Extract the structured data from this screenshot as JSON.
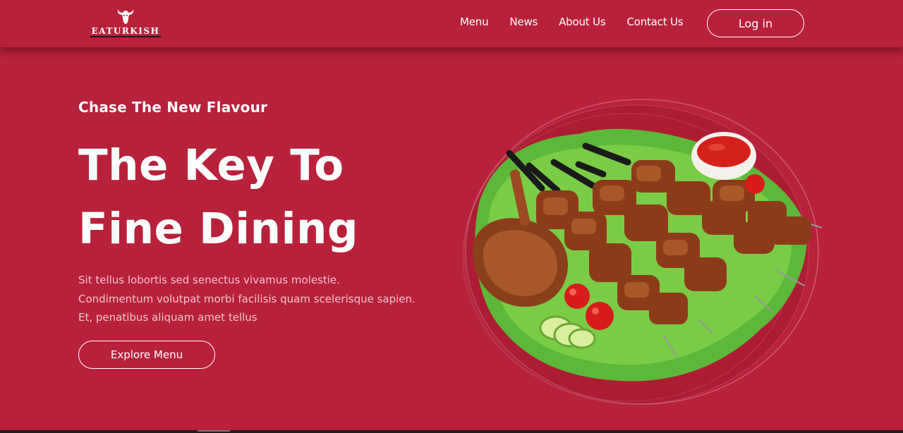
{
  "brand": {
    "name": "EATURKISH"
  },
  "nav": {
    "links": [
      "Menu",
      "News",
      "About Us",
      "Contact Us"
    ],
    "login_label": "Log in"
  },
  "hero": {
    "tagline": "Chase The New Flavour",
    "title_line1": "The Key To",
    "title_line2": "Fine Dining",
    "description": "Sit tellus lobortis sed senectus vivamus molestie. Condimentum volutpat morbi facilisis quam scelerisque sapien. Et, penatibus aliquam amet tellus",
    "cta_label": "Explore Menu",
    "image_icon": "kebab-platter-image"
  },
  "colors": {
    "background": "#b8213a",
    "text": "#ffffff",
    "muted_text": "#f2c2cb"
  }
}
